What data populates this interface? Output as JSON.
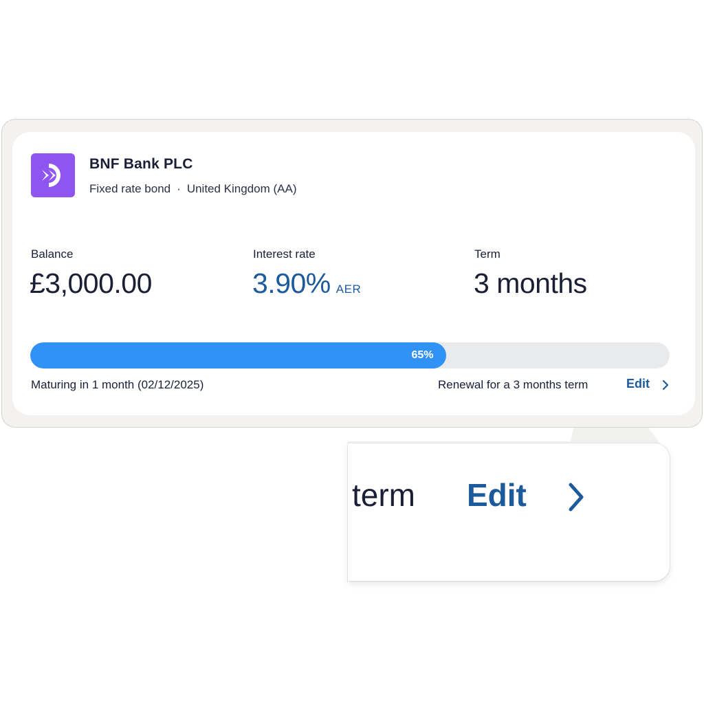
{
  "bank": {
    "name": "BNF Bank PLC",
    "product": "Fixed rate bond",
    "separator": "·",
    "country": "United Kingdom (AA)",
    "logo_icon": "bnf-logo-icon",
    "logo_color": "#8f55f0"
  },
  "stats": {
    "balance": {
      "label": "Balance",
      "value": "£3,000.00"
    },
    "interest": {
      "label": "Interest rate",
      "value": "3.90%",
      "unit": "AER"
    },
    "term": {
      "label": "Term",
      "value": "3 months"
    }
  },
  "progress": {
    "percent": 65,
    "label": "65%",
    "fill_color": "#3092f5",
    "track_color": "#e9eaec"
  },
  "footer": {
    "maturing": "Maturing in 1 month (02/12/2025)",
    "renewal": "Renewal for a 3 months term",
    "edit_label": "Edit",
    "edit_icon": "chevron-right-icon"
  },
  "zoom": {
    "term_text": "term",
    "edit_label": "Edit",
    "edit_icon": "chevron-right-icon"
  },
  "colors": {
    "accent": "#1c5a9c",
    "text": "#1a1f36"
  }
}
